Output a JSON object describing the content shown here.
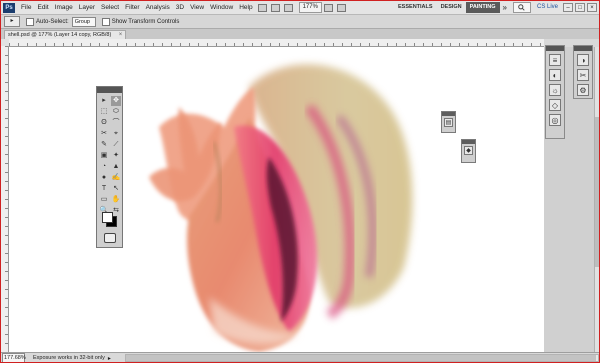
{
  "app": {
    "logo": "Ps",
    "menus": [
      "File",
      "Edit",
      "Image",
      "Layer",
      "Select",
      "Filter",
      "Analysis",
      "3D",
      "View",
      "Window",
      "Help"
    ],
    "zoom_select": "177%",
    "workspaces": [
      "ESSENTIALS",
      "DESIGN",
      "PAINTING"
    ],
    "active_workspace": "PAINTING",
    "more": "»",
    "cs_live": "CS Live",
    "window_controls": [
      "–",
      "□",
      "×"
    ]
  },
  "options": {
    "tool_preset": "▸",
    "auto_select_label": "Auto-Select:",
    "auto_select_value": "Group",
    "show_transform_label": "Show Transform Controls"
  },
  "document": {
    "tab_title": "shell.psd @ 177% (Layer 14 copy, RGB/8)",
    "close": "×"
  },
  "status": {
    "zoom": "177.68%",
    "message": "Exposure works in 32-bit only",
    "arrow": "▸"
  },
  "tools": {
    "icons": [
      "▸",
      "✥",
      "⬚",
      "⬭",
      "ʘ",
      "⌒",
      "✂",
      "⌖",
      "✎",
      "⟋",
      "▣",
      "✦",
      "◔",
      "▲",
      "●",
      "✍",
      "T",
      "↖",
      "▭",
      "✋",
      "🔍",
      "⇆"
    ]
  },
  "right_dock": {
    "panel1_icons": [
      "≡",
      "◐",
      "☼",
      "◇",
      "◎"
    ],
    "panel2_icons": [
      "◑",
      "✂",
      "⚙"
    ]
  },
  "colors": {
    "accent": "#d02020",
    "active_workspace_bg": "#5a5a5a"
  }
}
